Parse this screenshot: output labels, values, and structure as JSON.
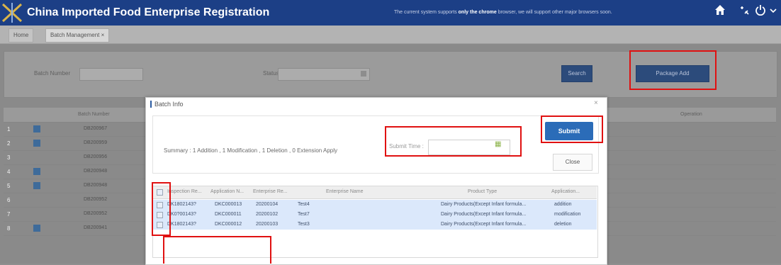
{
  "header": {
    "title": "China Imported Food Enterprise Registration",
    "notice_prefix": "The current system supports",
    "notice_bold": "only the chrome",
    "notice_suffix": "browser, we will support other major browsers soon.",
    "icons": [
      "home-icon",
      "pin-icon",
      "power-icon",
      "chevron-down-icon"
    ]
  },
  "tabs": [
    {
      "label": "Home"
    },
    {
      "label": "Batch Management ×"
    }
  ],
  "filter": {
    "batch_number_label": "Batch Number",
    "status_label": "Status",
    "search_label": "Search",
    "package_add_label": "Package Add"
  },
  "grid": {
    "headers": [
      "Batch Number",
      "Operation"
    ],
    "rows": [
      {
        "num": "1",
        "batch": "DB200967",
        "checked": true
      },
      {
        "num": "2",
        "batch": "DB200959",
        "checked": true
      },
      {
        "num": "3",
        "batch": "DB200956",
        "checked": false
      },
      {
        "num": "4",
        "batch": "DB200948",
        "checked": true
      },
      {
        "num": "5",
        "batch": "DB200948",
        "checked": true
      },
      {
        "num": "6",
        "batch": "DB200952",
        "checked": false
      },
      {
        "num": "7",
        "batch": "DB200952",
        "checked": false
      },
      {
        "num": "8",
        "batch": "DB200941",
        "checked": true
      }
    ]
  },
  "modal": {
    "title": "Batch Info",
    "close_glyph": "×",
    "summary": "Summary : 1 Addition , 1 Modification , 1 Deletion , 0 Extension Apply",
    "submit_time_label": "Submit Time :",
    "submit_time_value": "",
    "submit_label": "Submit",
    "close_label": "Close",
    "columns": [
      "Inspection Re...",
      "Application N...",
      "Enterprise Re...",
      "Enterprise Name",
      "Product Type",
      "Application..."
    ],
    "rows": [
      {
        "inspection": "DK1802143?",
        "application_no": "DKC000013",
        "enterprise_re": "20200104",
        "enterprise_name": "Test4",
        "product_type": "Dairy Products(Except Infant formula...",
        "application": "addition"
      },
      {
        "inspection": "DK0?00143?",
        "application_no": "DKC000011",
        "enterprise_re": "20200102",
        "enterprise_name": "Test7",
        "product_type": "Dairy Products(Except Infant formula...",
        "application": "modification"
      },
      {
        "inspection": "DK1802143?",
        "application_no": "DKC000012",
        "enterprise_re": "20200103",
        "enterprise_name": "Test3",
        "product_type": "Dairy Products(Except Infant formula...",
        "application": "deletion"
      }
    ]
  },
  "colors": {
    "header_bg": "#1c3f86",
    "accent": "#2b6cb8",
    "annotation_red": "#e01111",
    "row_selected": "#dbe8fb"
  }
}
